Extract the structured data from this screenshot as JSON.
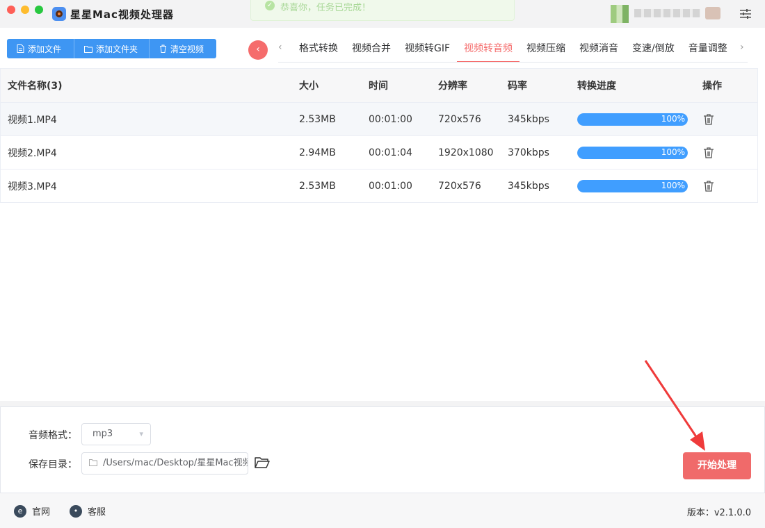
{
  "app": {
    "title": "星星Mac视频处理器"
  },
  "toast": {
    "text": "恭喜你，任务已完成！"
  },
  "toolbar": {
    "add_file": "添加文件",
    "add_folder": "添加文件夹",
    "clear_videos": "清空视频"
  },
  "tabs": [
    {
      "label": "格式转换"
    },
    {
      "label": "视频合并"
    },
    {
      "label": "视频转GIF"
    },
    {
      "label": "视频转音频",
      "active": true
    },
    {
      "label": "视频压缩"
    },
    {
      "label": "视频消音"
    },
    {
      "label": "变速/倒放"
    },
    {
      "label": "音量调整"
    }
  ],
  "table": {
    "headers": [
      "文件名称(3)",
      "大小",
      "时间",
      "分辨率",
      "码率",
      "转换进度",
      "操作"
    ],
    "rows": [
      {
        "name": "视频1.MP4",
        "size": "2.53MB",
        "time": "00:01:00",
        "resolution": "720x576",
        "bitrate": "345kbps",
        "progress_text": "100%",
        "progress": 1.0
      },
      {
        "name": "视频2.MP4",
        "size": "2.94MB",
        "time": "00:01:04",
        "resolution": "1920x1080",
        "bitrate": "370kbps",
        "progress_text": "100%",
        "progress": 1.0
      },
      {
        "name": "视频3.MP4",
        "size": "2.53MB",
        "time": "00:01:00",
        "resolution": "720x576",
        "bitrate": "345kbps",
        "progress_text": "100%",
        "progress": 1.0
      }
    ]
  },
  "settings": {
    "audio_format_label": "音频格式：",
    "audio_format_value": "mp3",
    "save_dir_label": "保存目录：",
    "save_dir_value": "/Users/mac/Desktop/星星Mac视频"
  },
  "actions": {
    "start": "开始处理"
  },
  "footer": {
    "website": "官网",
    "support": "客服",
    "version": "版本：v2.1.0.0"
  },
  "colors": {
    "accent": "#f56c6c",
    "primary": "#409eff"
  }
}
